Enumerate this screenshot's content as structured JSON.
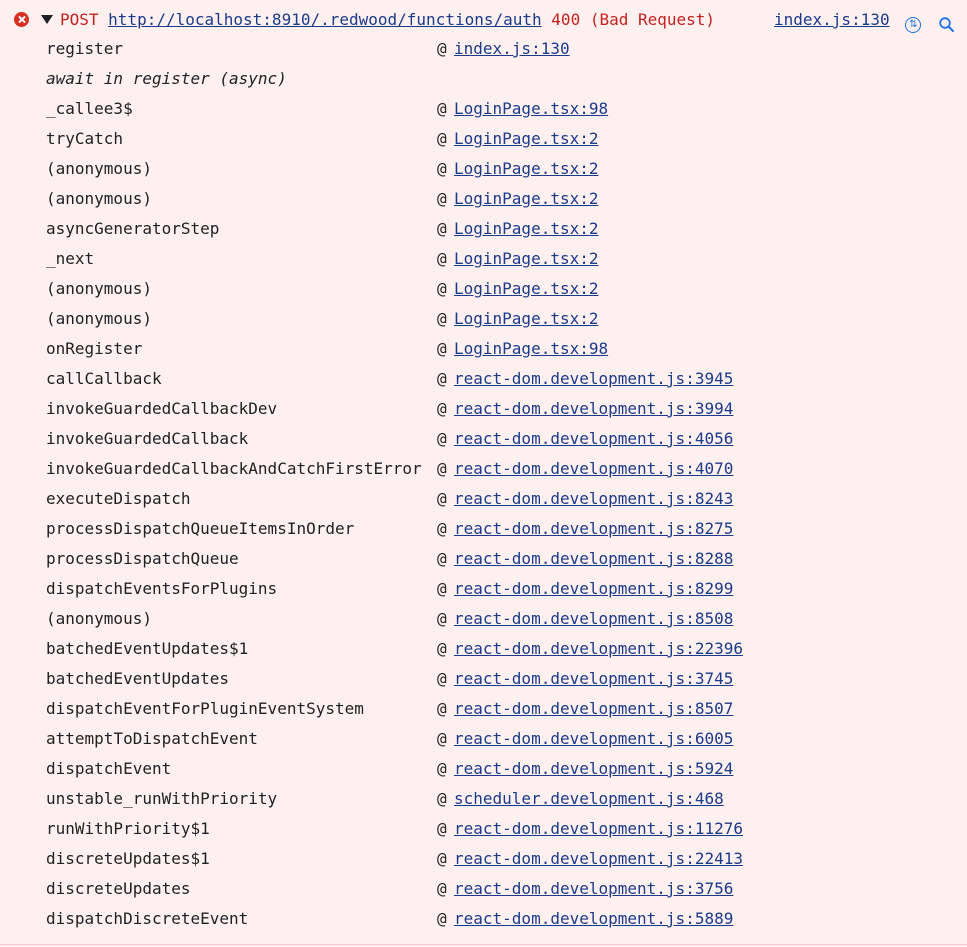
{
  "header": {
    "method": "POST",
    "url": "http://localhost:8910/.redwood/functions/auth",
    "status": "400 (Bad Request)",
    "source_link": "index.js:130",
    "icons": [
      "error-icon",
      "expand-caret-icon",
      "network-request-icon",
      "search-icon"
    ],
    "colors": {
      "background": "#fff0f0",
      "error_text": "#c5221f",
      "link": "#1a3a8a",
      "icon_accent": "#1a73e8"
    }
  },
  "at_symbol": "@",
  "stack": [
    {
      "fn": "register",
      "loc": "index.js:130"
    },
    {
      "fn": "await in register (async)",
      "loc": ""
    },
    {
      "fn": "_callee3$",
      "loc": "LoginPage.tsx:98"
    },
    {
      "fn": "tryCatch",
      "loc": "LoginPage.tsx:2"
    },
    {
      "fn": "(anonymous)",
      "loc": "LoginPage.tsx:2"
    },
    {
      "fn": "(anonymous)",
      "loc": "LoginPage.tsx:2"
    },
    {
      "fn": "asyncGeneratorStep",
      "loc": "LoginPage.tsx:2"
    },
    {
      "fn": "_next",
      "loc": "LoginPage.tsx:2"
    },
    {
      "fn": "(anonymous)",
      "loc": "LoginPage.tsx:2"
    },
    {
      "fn": "(anonymous)",
      "loc": "LoginPage.tsx:2"
    },
    {
      "fn": "onRegister",
      "loc": "LoginPage.tsx:98"
    },
    {
      "fn": "callCallback",
      "loc": "react-dom.development.js:3945"
    },
    {
      "fn": "invokeGuardedCallbackDev",
      "loc": "react-dom.development.js:3994"
    },
    {
      "fn": "invokeGuardedCallback",
      "loc": "react-dom.development.js:4056"
    },
    {
      "fn": "invokeGuardedCallbackAndCatchFirstError",
      "loc": "react-dom.development.js:4070"
    },
    {
      "fn": "executeDispatch",
      "loc": "react-dom.development.js:8243"
    },
    {
      "fn": "processDispatchQueueItemsInOrder",
      "loc": "react-dom.development.js:8275"
    },
    {
      "fn": "processDispatchQueue",
      "loc": "react-dom.development.js:8288"
    },
    {
      "fn": "dispatchEventsForPlugins",
      "loc": "react-dom.development.js:8299"
    },
    {
      "fn": "(anonymous)",
      "loc": "react-dom.development.js:8508"
    },
    {
      "fn": "batchedEventUpdates$1",
      "loc": "react-dom.development.js:22396"
    },
    {
      "fn": "batchedEventUpdates",
      "loc": "react-dom.development.js:3745"
    },
    {
      "fn": "dispatchEventForPluginEventSystem",
      "loc": "react-dom.development.js:8507"
    },
    {
      "fn": "attemptToDispatchEvent",
      "loc": "react-dom.development.js:6005"
    },
    {
      "fn": "dispatchEvent",
      "loc": "react-dom.development.js:5924"
    },
    {
      "fn": "unstable_runWithPriority",
      "loc": "scheduler.development.js:468"
    },
    {
      "fn": "runWithPriority$1",
      "loc": "react-dom.development.js:11276"
    },
    {
      "fn": "discreteUpdates$1",
      "loc": "react-dom.development.js:22413"
    },
    {
      "fn": "discreteUpdates",
      "loc": "react-dom.development.js:3756"
    },
    {
      "fn": "dispatchDiscreteEvent",
      "loc": "react-dom.development.js:5889"
    }
  ]
}
